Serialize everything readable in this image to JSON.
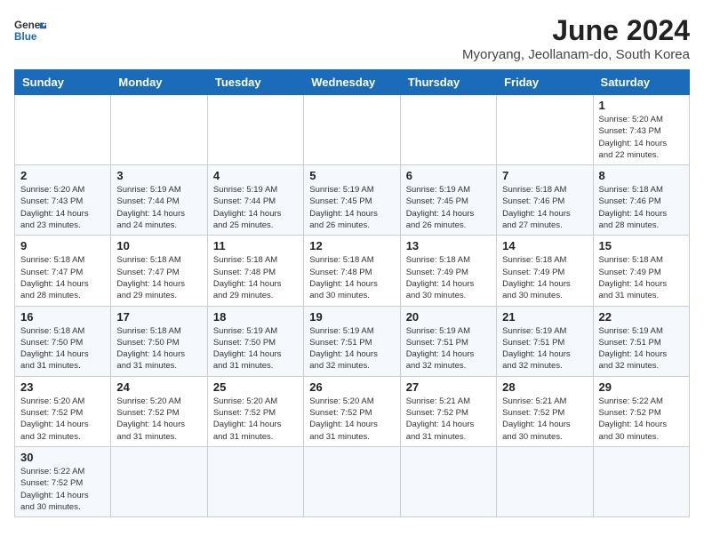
{
  "header": {
    "logo_general": "General",
    "logo_blue": "Blue",
    "month_title": "June 2024",
    "location": "Myoryang, Jeollanam-do, South Korea"
  },
  "days_of_week": [
    "Sunday",
    "Monday",
    "Tuesday",
    "Wednesday",
    "Thursday",
    "Friday",
    "Saturday"
  ],
  "weeks": [
    [
      {
        "day": "",
        "info": ""
      },
      {
        "day": "",
        "info": ""
      },
      {
        "day": "",
        "info": ""
      },
      {
        "day": "",
        "info": ""
      },
      {
        "day": "",
        "info": ""
      },
      {
        "day": "",
        "info": ""
      },
      {
        "day": "1",
        "info": "Sunrise: 5:20 AM\nSunset: 7:43 PM\nDaylight: 14 hours\nand 22 minutes."
      }
    ],
    [
      {
        "day": "2",
        "info": "Sunrise: 5:20 AM\nSunset: 7:43 PM\nDaylight: 14 hours\nand 23 minutes."
      },
      {
        "day": "3",
        "info": "Sunrise: 5:19 AM\nSunset: 7:44 PM\nDaylight: 14 hours\nand 24 minutes."
      },
      {
        "day": "4",
        "info": "Sunrise: 5:19 AM\nSunset: 7:44 PM\nDaylight: 14 hours\nand 25 minutes."
      },
      {
        "day": "5",
        "info": "Sunrise: 5:19 AM\nSunset: 7:45 PM\nDaylight: 14 hours\nand 26 minutes."
      },
      {
        "day": "6",
        "info": "Sunrise: 5:19 AM\nSunset: 7:45 PM\nDaylight: 14 hours\nand 26 minutes."
      },
      {
        "day": "7",
        "info": "Sunrise: 5:18 AM\nSunset: 7:46 PM\nDaylight: 14 hours\nand 27 minutes."
      },
      {
        "day": "8",
        "info": "Sunrise: 5:18 AM\nSunset: 7:46 PM\nDaylight: 14 hours\nand 28 minutes."
      }
    ],
    [
      {
        "day": "9",
        "info": "Sunrise: 5:18 AM\nSunset: 7:47 PM\nDaylight: 14 hours\nand 28 minutes."
      },
      {
        "day": "10",
        "info": "Sunrise: 5:18 AM\nSunset: 7:47 PM\nDaylight: 14 hours\nand 29 minutes."
      },
      {
        "day": "11",
        "info": "Sunrise: 5:18 AM\nSunset: 7:48 PM\nDaylight: 14 hours\nand 29 minutes."
      },
      {
        "day": "12",
        "info": "Sunrise: 5:18 AM\nSunset: 7:48 PM\nDaylight: 14 hours\nand 30 minutes."
      },
      {
        "day": "13",
        "info": "Sunrise: 5:18 AM\nSunset: 7:49 PM\nDaylight: 14 hours\nand 30 minutes."
      },
      {
        "day": "14",
        "info": "Sunrise: 5:18 AM\nSunset: 7:49 PM\nDaylight: 14 hours\nand 30 minutes."
      },
      {
        "day": "15",
        "info": "Sunrise: 5:18 AM\nSunset: 7:49 PM\nDaylight: 14 hours\nand 31 minutes."
      }
    ],
    [
      {
        "day": "16",
        "info": "Sunrise: 5:18 AM\nSunset: 7:50 PM\nDaylight: 14 hours\nand 31 minutes."
      },
      {
        "day": "17",
        "info": "Sunrise: 5:18 AM\nSunset: 7:50 PM\nDaylight: 14 hours\nand 31 minutes."
      },
      {
        "day": "18",
        "info": "Sunrise: 5:19 AM\nSunset: 7:50 PM\nDaylight: 14 hours\nand 31 minutes."
      },
      {
        "day": "19",
        "info": "Sunrise: 5:19 AM\nSunset: 7:51 PM\nDaylight: 14 hours\nand 32 minutes."
      },
      {
        "day": "20",
        "info": "Sunrise: 5:19 AM\nSunset: 7:51 PM\nDaylight: 14 hours\nand 32 minutes."
      },
      {
        "day": "21",
        "info": "Sunrise: 5:19 AM\nSunset: 7:51 PM\nDaylight: 14 hours\nand 32 minutes."
      },
      {
        "day": "22",
        "info": "Sunrise: 5:19 AM\nSunset: 7:51 PM\nDaylight: 14 hours\nand 32 minutes."
      }
    ],
    [
      {
        "day": "23",
        "info": "Sunrise: 5:20 AM\nSunset: 7:52 PM\nDaylight: 14 hours\nand 32 minutes."
      },
      {
        "day": "24",
        "info": "Sunrise: 5:20 AM\nSunset: 7:52 PM\nDaylight: 14 hours\nand 31 minutes."
      },
      {
        "day": "25",
        "info": "Sunrise: 5:20 AM\nSunset: 7:52 PM\nDaylight: 14 hours\nand 31 minutes."
      },
      {
        "day": "26",
        "info": "Sunrise: 5:20 AM\nSunset: 7:52 PM\nDaylight: 14 hours\nand 31 minutes."
      },
      {
        "day": "27",
        "info": "Sunrise: 5:21 AM\nSunset: 7:52 PM\nDaylight: 14 hours\nand 31 minutes."
      },
      {
        "day": "28",
        "info": "Sunrise: 5:21 AM\nSunset: 7:52 PM\nDaylight: 14 hours\nand 30 minutes."
      },
      {
        "day": "29",
        "info": "Sunrise: 5:22 AM\nSunset: 7:52 PM\nDaylight: 14 hours\nand 30 minutes."
      }
    ],
    [
      {
        "day": "30",
        "info": "Sunrise: 5:22 AM\nSunset: 7:52 PM\nDaylight: 14 hours\nand 30 minutes."
      },
      {
        "day": "",
        "info": ""
      },
      {
        "day": "",
        "info": ""
      },
      {
        "day": "",
        "info": ""
      },
      {
        "day": "",
        "info": ""
      },
      {
        "day": "",
        "info": ""
      },
      {
        "day": "",
        "info": ""
      }
    ]
  ]
}
